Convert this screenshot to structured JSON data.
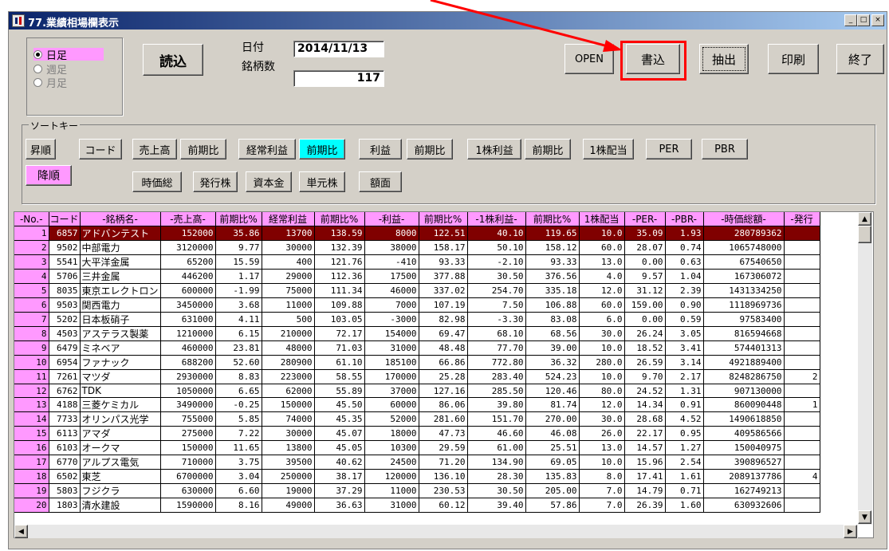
{
  "window": {
    "title": "77.業績相場欄表示",
    "min_label": "_",
    "max_label": "□",
    "close_label": "×"
  },
  "period": {
    "options": [
      "日足",
      "週足",
      "月足"
    ]
  },
  "toolbar": {
    "load": "読込",
    "open": "OPEN",
    "write": "書込",
    "extract": "抽出",
    "print": "印刷",
    "exit": "終了"
  },
  "info": {
    "date_label": "日付",
    "date_value": "2014/11/13",
    "count_label": "銘柄数",
    "count_value": "117"
  },
  "sort": {
    "caption": "ソートキー",
    "asc": "昇順",
    "desc": "降順",
    "code": "コード",
    "sales": "売上高",
    "sales_chg": "前期比",
    "ordinary": "経常利益",
    "ordinary_chg": "前期比",
    "profit": "利益",
    "profit_chg": "前期比",
    "eps": "1株利益",
    "eps_chg": "前期比",
    "dividend": "1株配当",
    "per": "PER",
    "pbr": "PBR",
    "mcap": "時価総",
    "shares": "発行株",
    "capital": "資本金",
    "unit": "単元株",
    "par": "額面"
  },
  "table": {
    "headers": [
      "-No.-",
      "コード",
      "-銘柄名-",
      "-売上高-",
      "前期比%",
      "経常利益",
      "前期比%",
      "-利益-",
      "前期比%",
      "-1株利益-",
      "前期比%",
      "1株配当",
      "-PER-",
      "-PBR-",
      "-時価総額-",
      "-発行"
    ],
    "rows": [
      [
        "1",
        "6857",
        "アドバンテスト",
        "152000",
        "35.86",
        "13700",
        "138.59",
        "8000",
        "122.51",
        "40.10",
        "119.65",
        "10.0",
        "35.09",
        "1.93",
        "280789362",
        ""
      ],
      [
        "2",
        "9502",
        "中部電力",
        "3120000",
        "9.77",
        "30000",
        "132.39",
        "38000",
        "158.17",
        "50.10",
        "158.12",
        "60.0",
        "28.07",
        "0.74",
        "1065748000",
        ""
      ],
      [
        "3",
        "5541",
        "大平洋金属",
        "65200",
        "15.59",
        "400",
        "121.76",
        "-410",
        "93.33",
        "-2.10",
        "93.33",
        "13.0",
        "0.00",
        "0.63",
        "67540650",
        ""
      ],
      [
        "4",
        "5706",
        "三井金属",
        "446200",
        "1.17",
        "29000",
        "112.36",
        "17500",
        "377.88",
        "30.50",
        "376.56",
        "4.0",
        "9.57",
        "1.04",
        "167306072",
        ""
      ],
      [
        "5",
        "8035",
        "東京エレクトロン",
        "600000",
        "-1.99",
        "75000",
        "111.34",
        "46000",
        "337.02",
        "254.70",
        "335.18",
        "12.0",
        "31.12",
        "2.39",
        "1431334250",
        ""
      ],
      [
        "6",
        "9503",
        "関西電力",
        "3450000",
        "3.68",
        "11000",
        "109.88",
        "7000",
        "107.19",
        "7.50",
        "106.88",
        "60.0",
        "159.00",
        "0.90",
        "1118969736",
        ""
      ],
      [
        "7",
        "5202",
        "日本板硝子",
        "631000",
        "4.11",
        "500",
        "103.05",
        "-3000",
        "82.98",
        "-3.30",
        "83.08",
        "6.0",
        "0.00",
        "0.59",
        "97583400",
        ""
      ],
      [
        "8",
        "4503",
        "アステラス製薬",
        "1210000",
        "6.15",
        "210000",
        "72.17",
        "154000",
        "69.47",
        "68.10",
        "68.56",
        "30.0",
        "26.24",
        "3.05",
        "816594668",
        ""
      ],
      [
        "9",
        "6479",
        "ミネベア",
        "460000",
        "23.81",
        "48000",
        "71.03",
        "31000",
        "48.48",
        "77.70",
        "39.00",
        "10.0",
        "18.52",
        "3.41",
        "574401313",
        ""
      ],
      [
        "10",
        "6954",
        "ファナック",
        "688200",
        "52.60",
        "280900",
        "61.10",
        "185100",
        "66.86",
        "772.80",
        "36.32",
        "280.0",
        "26.59",
        "3.14",
        "4921889400",
        ""
      ],
      [
        "11",
        "7261",
        "マツダ",
        "2930000",
        "8.83",
        "223000",
        "58.55",
        "170000",
        "25.28",
        "283.40",
        "524.23",
        "10.0",
        "9.70",
        "2.17",
        "8248286750",
        "2"
      ],
      [
        "12",
        "6762",
        "TDK",
        "1050000",
        "6.65",
        "62000",
        "55.89",
        "37000",
        "127.16",
        "285.50",
        "120.46",
        "80.0",
        "24.52",
        "1.31",
        "907130000",
        ""
      ],
      [
        "13",
        "4188",
        "三菱ケミカル",
        "3490000",
        "-0.25",
        "150000",
        "45.50",
        "60000",
        "86.06",
        "39.80",
        "81.74",
        "12.0",
        "14.34",
        "0.91",
        "860090448",
        "1"
      ],
      [
        "14",
        "7733",
        "オリンパス光学",
        "755000",
        "5.85",
        "74000",
        "45.35",
        "52000",
        "281.60",
        "151.70",
        "270.00",
        "30.0",
        "28.68",
        "4.52",
        "1490618850",
        ""
      ],
      [
        "15",
        "6113",
        "アマダ",
        "275000",
        "7.22",
        "30000",
        "45.07",
        "18000",
        "47.73",
        "46.60",
        "46.08",
        "26.0",
        "22.17",
        "0.95",
        "409586566",
        ""
      ],
      [
        "16",
        "6103",
        "オークマ",
        "150000",
        "11.65",
        "13800",
        "45.05",
        "10300",
        "29.59",
        "61.00",
        "25.51",
        "13.0",
        "14.57",
        "1.27",
        "150040975",
        ""
      ],
      [
        "17",
        "6770",
        "アルプス電気",
        "710000",
        "3.75",
        "39500",
        "40.62",
        "24500",
        "71.20",
        "134.90",
        "69.05",
        "10.0",
        "15.96",
        "2.54",
        "390896527",
        ""
      ],
      [
        "18",
        "6502",
        "東芝",
        "6700000",
        "3.04",
        "250000",
        "38.17",
        "120000",
        "136.10",
        "28.30",
        "135.83",
        "8.0",
        "17.41",
        "1.61",
        "2089137786",
        "4"
      ],
      [
        "19",
        "5803",
        "フジクラ",
        "630000",
        "6.60",
        "19000",
        "37.29",
        "11000",
        "230.53",
        "30.50",
        "205.00",
        "7.0",
        "14.79",
        "0.71",
        "162749213",
        ""
      ],
      [
        "20",
        "1803",
        "清水建設",
        "1590000",
        "8.16",
        "49000",
        "36.63",
        "31000",
        "60.12",
        "39.40",
        "57.86",
        "7.0",
        "26.39",
        "1.60",
        "630932606",
        ""
      ]
    ]
  },
  "colors": {
    "pink": "#ff99ff",
    "cyan": "#00ffff",
    "maroon": "#800000",
    "annotation": "#ff0000"
  }
}
